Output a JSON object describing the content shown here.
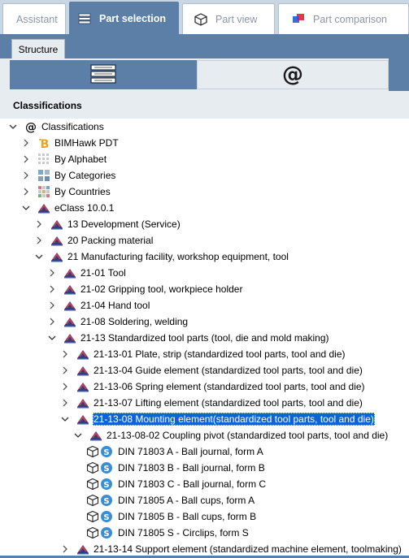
{
  "tabs": [
    {
      "label": "Assistant",
      "active": false,
      "icon": "none"
    },
    {
      "label": "Part selection",
      "active": true,
      "icon": "books-icon"
    },
    {
      "label": "Part view",
      "active": false,
      "icon": "cube-icon"
    },
    {
      "label": "Part comparison",
      "active": false,
      "icon": "compare-icon"
    }
  ],
  "structure_tab": "Structure",
  "toggle": {
    "left_icon": "books-icon",
    "right_icon": "at-icon",
    "right_glyph": "@"
  },
  "section_title": "Classifications",
  "colors": {
    "accent": "#5b7fa6",
    "selection": "#0a64d6",
    "panel": "#e7ecf1"
  },
  "tree": [
    {
      "label": "Classifications",
      "level": 0,
      "expanded": true,
      "icon": "at-icon"
    },
    {
      "label": "BIMHawk PDT",
      "level": 1,
      "expanded": false,
      "icon": "bimhawk-icon"
    },
    {
      "label": "By Alphabet",
      "level": 1,
      "expanded": false,
      "icon": "alphabet-grid-icon"
    },
    {
      "label": "By Categories",
      "level": 1,
      "expanded": false,
      "icon": "categories-grid-icon"
    },
    {
      "label": "By Countries",
      "level": 1,
      "expanded": false,
      "icon": "countries-grid-icon"
    },
    {
      "label": "eClass 10.0.1",
      "level": 1,
      "expanded": true,
      "icon": "eclass-icon"
    },
    {
      "label": "13 Development (Service)",
      "level": 2,
      "expanded": false,
      "icon": "eclass-icon"
    },
    {
      "label": "20 Packing material",
      "level": 2,
      "expanded": false,
      "icon": "eclass-icon"
    },
    {
      "label": "21 Manufacturing facility, workshop equipment, tool",
      "level": 2,
      "expanded": true,
      "icon": "eclass-icon"
    },
    {
      "label": "21-01 Tool",
      "level": 3,
      "expanded": false,
      "icon": "eclass-icon"
    },
    {
      "label": "21-02 Gripping tool, workpiece holder",
      "level": 3,
      "expanded": false,
      "icon": "eclass-icon"
    },
    {
      "label": "21-04 Hand tool",
      "level": 3,
      "expanded": false,
      "icon": "eclass-icon"
    },
    {
      "label": "21-08 Soldering, welding",
      "level": 3,
      "expanded": false,
      "icon": "eclass-icon"
    },
    {
      "label": "21-13 Standardized tool parts (tool, die and mold making)",
      "level": 3,
      "expanded": true,
      "icon": "eclass-icon"
    },
    {
      "label": "21-13-01 Plate, strip (standardized tool parts, tool and die)",
      "level": 4,
      "expanded": false,
      "icon": "eclass-icon"
    },
    {
      "label": "21-13-04 Guide element (standardized tool parts, tool and die)",
      "level": 4,
      "expanded": false,
      "icon": "eclass-icon"
    },
    {
      "label": "21-13-06 Spring element (standardized tool parts, tool and die)",
      "level": 4,
      "expanded": false,
      "icon": "eclass-icon"
    },
    {
      "label": "21-13-07 Lifting element (standardized tool parts, tool and die)",
      "level": 4,
      "expanded": false,
      "icon": "eclass-icon"
    },
    {
      "label": "21-13-08 Mounting element(standardized tool parts, tool and die)",
      "level": 4,
      "expanded": true,
      "icon": "eclass-icon",
      "selected": true
    },
    {
      "label": "21-13-08-02 Coupling pivot (standardized tool parts, tool and die)",
      "level": 5,
      "expanded": true,
      "icon": "eclass-icon"
    },
    {
      "label": "DIN 71803 A - Ball journal, form A",
      "level": 6,
      "leaf": true,
      "icon": "part-icon"
    },
    {
      "label": "DIN 71803 B - Ball journal, form B",
      "level": 6,
      "leaf": true,
      "icon": "part-icon"
    },
    {
      "label": "DIN 71803 C - Ball journal, form C",
      "level": 6,
      "leaf": true,
      "icon": "part-icon"
    },
    {
      "label": "DIN 71805 A - Ball cups, form A",
      "level": 6,
      "leaf": true,
      "icon": "part-icon"
    },
    {
      "label": "DIN 71805 B - Ball cups, form B",
      "level": 6,
      "leaf": true,
      "icon": "part-icon"
    },
    {
      "label": "DIN 71805 S - Circlips, form S",
      "level": 6,
      "leaf": true,
      "icon": "part-icon"
    },
    {
      "label": "21-13-14 Support element (standardized machine element, toolmaking)",
      "level": 4,
      "expanded": false,
      "icon": "eclass-icon"
    }
  ]
}
